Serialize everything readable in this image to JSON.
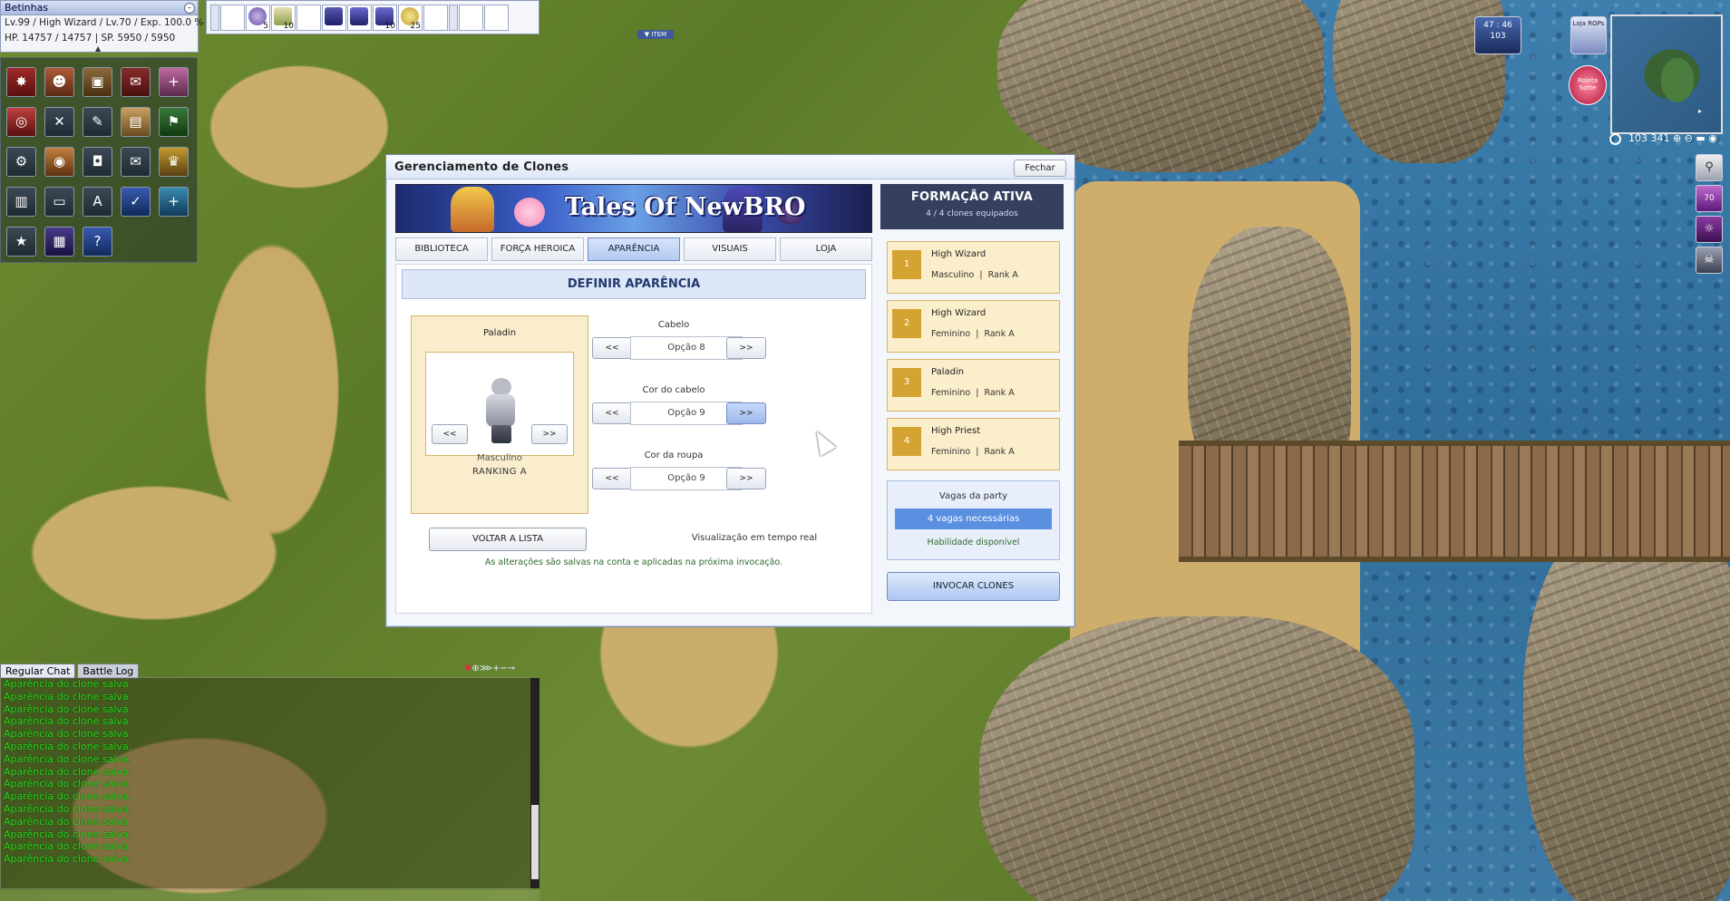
{
  "status": {
    "name": "Betinhas",
    "line1": "Lv.99 / High Wizard / Lv.70 / Exp. 100.0 %",
    "line2": "HP. 14757 / 14757 | SP. 5950 / 5950"
  },
  "hotbar": {
    "qty": [
      "5",
      "10",
      "10",
      "25"
    ],
    "item_tag": "▼ ITEM"
  },
  "menu_icons": [
    "skill-icon",
    "pet-icon",
    "inventory-icon",
    "quest-icon",
    "party-add-icon",
    "guild-icon",
    "battle-icon",
    "equip-icon",
    "map-icon",
    "ranking-icon",
    "options-icon",
    "bag-icon",
    "camera-icon",
    "mail-icon",
    "trophy-icon",
    "book-icon",
    "shop-icon",
    "text-icon",
    "calendar-icon",
    "friend-icon",
    "achievement-icon",
    "storage-icon",
    "help-icon"
  ],
  "minimap": {
    "coords": "103 341"
  },
  "top_icons": {
    "timer_top": "47 : 46",
    "timer_bottom": "103",
    "shop": "Loja ROPs",
    "roulette": "Roleta Sorte",
    "level_badge": "70"
  },
  "chat": {
    "tabs": [
      "Regular Chat",
      "Battle Log"
    ],
    "messages": [
      "Aparência do clone salva.",
      "Aparência do clone salva.",
      "Aparência do clone salva.",
      "Aparência do clone salva.",
      "Aparência do clone salva.",
      "Aparência do clone salva.",
      "Aparência do clone salva.",
      "Aparência do clone salva.",
      "Aparência do clone salva.",
      "Aparência do clone salva.",
      "Aparência do clone salva.",
      "Aparência do clone salva.",
      "Aparência do clone salva.",
      "Aparência do clone salva.",
      "Aparência do clone salva."
    ]
  },
  "dialog": {
    "title": "Gerenciamento de Clones",
    "close": "Fechar",
    "banner": "Tales Of NewBRO",
    "tabs": [
      "BIBLIOTECA",
      "FORÇA HEROICA",
      "APARÊNCIA",
      "VISUAIS",
      "LOJA"
    ],
    "active_tab": "APARÊNCIA",
    "section_title": "DEFINIR APARÊNCIA",
    "preview": {
      "class": "Paladin",
      "prev": "<<",
      "next": ">>",
      "gender": "Masculino",
      "rank": "RANKING A"
    },
    "options": [
      {
        "label": "Cabelo",
        "value": "Opção 8",
        "prev": "<<",
        "next": ">>"
      },
      {
        "label": "Cor do cabelo",
        "value": "Opção 9",
        "prev": "<<",
        "next": ">>"
      },
      {
        "label": "Cor da roupa",
        "value": "Opção 9",
        "prev": "<<",
        "next": ">>"
      }
    ],
    "back": "VOLTAR A LISTA",
    "realtime": "Visualização em tempo real",
    "note": "As alterações são salvas na conta e aplicadas na próxima invocação.",
    "formation": {
      "title": "FORMAÇÃO ATIVA",
      "subtitle": "4 / 4 clones equipados",
      "clones": [
        {
          "num": "1",
          "name": "High Wizard",
          "info": "Masculino  |  Rank A"
        },
        {
          "num": "2",
          "name": "High Wizard",
          "info": "Feminino  |  Rank A"
        },
        {
          "num": "3",
          "name": "Paladin",
          "info": "Feminino  |  Rank A"
        },
        {
          "num": "4",
          "name": "High Priest",
          "info": "Feminino  |  Rank A"
        }
      ]
    },
    "party": {
      "title": "Vagas da party",
      "needed": "4 vagas necessárias",
      "skill": "Habilidade disponível"
    },
    "invoke": "INVOCAR CLONES"
  }
}
